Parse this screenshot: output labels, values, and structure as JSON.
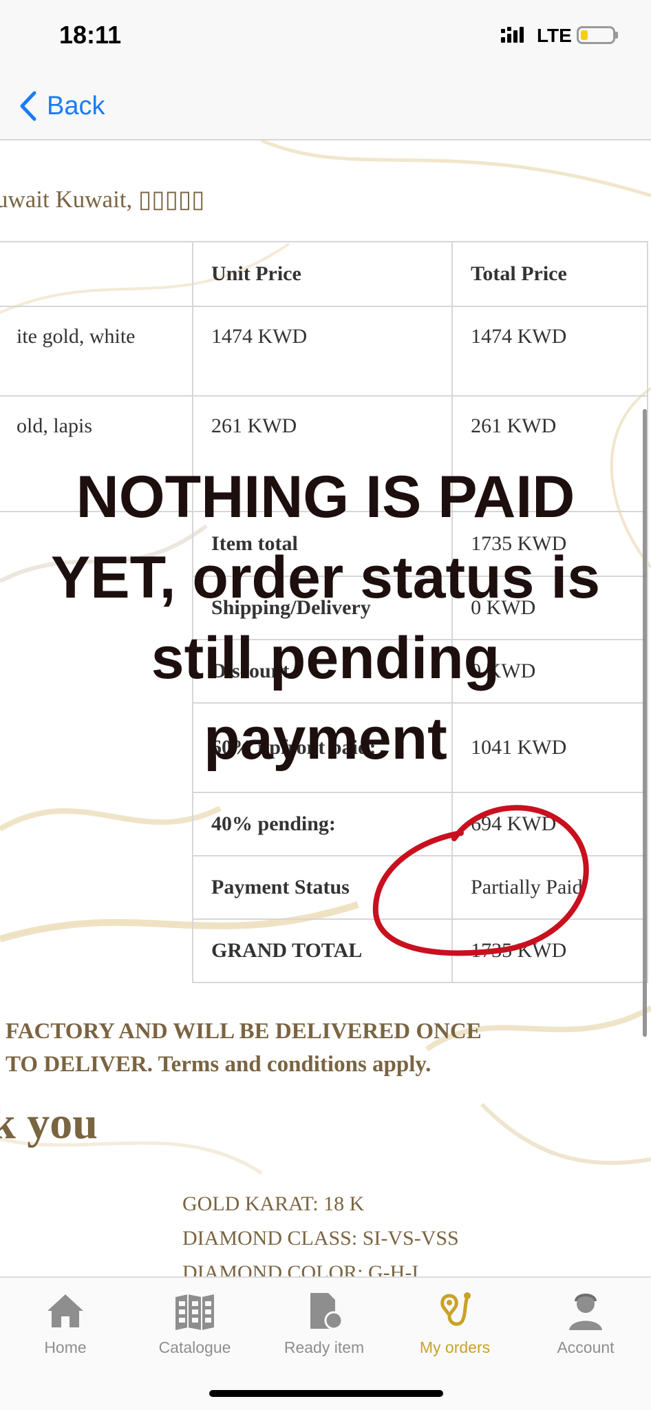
{
  "status_bar": {
    "time": "18:11",
    "network": "LTE"
  },
  "nav": {
    "back_label": "Back"
  },
  "address": "uwait Kuwait, ▯▯▯▯▯",
  "table": {
    "headers": [
      "",
      "Unit Price",
      "Total Price"
    ],
    "items": [
      {
        "name": "ite gold, white",
        "unit": "1474 KWD",
        "total": "1474 KWD"
      },
      {
        "name": "old, lapis",
        "unit": "261 KWD",
        "total": "261 KWD"
      }
    ],
    "summary": [
      {
        "label": "Item total",
        "value": "1735 KWD"
      },
      {
        "label": "Shipping/Delivery",
        "value": "0 KWD"
      },
      {
        "label": "Discount",
        "value": "0 KWD"
      },
      {
        "label": "60% upfront paid:",
        "value": "1041 KWD"
      },
      {
        "label": "40% pending:",
        "value": "694 KWD"
      },
      {
        "label": "Payment Status",
        "value": "Partially Paid"
      },
      {
        "label": "GRAND TOTAL",
        "value": "1735 KWD"
      }
    ]
  },
  "footer": {
    "line1": "FACTORY AND WILL BE DELIVERED ONCE",
    "line2": "TO DELIVER. Terms and conditions apply.",
    "thanks": "k you",
    "specs": [
      "GOLD KARAT: 18 K",
      "DIAMOND CLASS: SI-VS-VSS",
      "DIAMOND COLOR: G-H-I"
    ]
  },
  "annotation": {
    "text_lines": [
      "NOTHING IS PAID",
      "YET, order status is",
      "still pending",
      "payment"
    ],
    "circle_color": "#c8101e"
  },
  "tabs": [
    {
      "label": "Home",
      "icon": "home-icon",
      "active": false
    },
    {
      "label": "Catalogue",
      "icon": "catalogue-icon",
      "active": false
    },
    {
      "label": "Ready item",
      "icon": "ready-item-icon",
      "active": false
    },
    {
      "label": "My orders",
      "icon": "my-orders-icon",
      "active": true
    },
    {
      "label": "Account",
      "icon": "account-icon",
      "active": false
    }
  ],
  "colors": {
    "accent_gold": "#7a6441",
    "tab_active": "#c9a227",
    "link_blue": "#1a7cf5"
  }
}
